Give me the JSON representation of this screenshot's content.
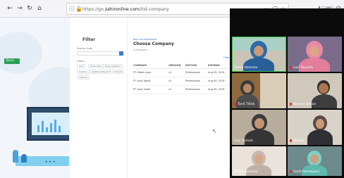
{
  "browser": {
    "url_prefix": "https://go.",
    "url_domain": "zahironline.com",
    "url_path": "/list-company",
    "zoom": "50%",
    "icons": [
      "back-arrow-icon",
      "forward-arrow-icon",
      "reload-icon",
      "home-icon",
      "info-icon",
      "lock-icon",
      "more-icon",
      "pocket-icon",
      "bookmark-star-icon",
      "library-icon",
      "sidebar-icon",
      "account-icon"
    ]
  },
  "page": {
    "left_button": "Back",
    "filter": {
      "title": "Filter",
      "label_1": "Expires Date",
      "label_2": "Status",
      "chips": [
        "Trial",
        "Fresh Start",
        "Early Adopters",
        "Inactive",
        "Awaiting Payment",
        "Expired",
        "Inactive"
      ]
    },
    "content": {
      "back_link": "Back to Dashboard",
      "title": "Choose Company",
      "count": "3 Company",
      "filter_link": "Filter",
      "columns": [
        "COMPANY",
        "VERSION",
        "EDITION",
        "EXPIRED"
      ],
      "rows": [
        [
          "PT. Maleh Jaya",
          "v1",
          "Professional",
          "Aug 09, 2019"
        ],
        [
          "PT. Jaya Abadi",
          "v1",
          "Professional",
          "Aug 09, 2019"
        ],
        [
          "PT. Jaya Indah",
          "v1",
          "Professional",
          "Aug 09, 2019"
        ]
      ]
    }
  },
  "video_call": {
    "participants": [
      {
        "name": "Zahra Iskandar",
        "muted": false
      },
      {
        "name": "Lusi Yayantu",
        "muted": true
      },
      {
        "name": "Tanti Titiek",
        "muted": true
      },
      {
        "name": "Wawan Ikhsan",
        "muted": true
      },
      {
        "name": "Lely Humah",
        "muted": false
      },
      {
        "name": "Andina",
        "muted": true
      },
      {
        "name": "Zahra Iskandar",
        "muted": false
      },
      {
        "name": "Santi Handayani",
        "muted": true
      }
    ]
  },
  "colors": {
    "accent_blue": "#3f78c8",
    "button_green": "#2aa155",
    "active_speaker": "#39c04a",
    "muted_red": "#e0322b"
  }
}
